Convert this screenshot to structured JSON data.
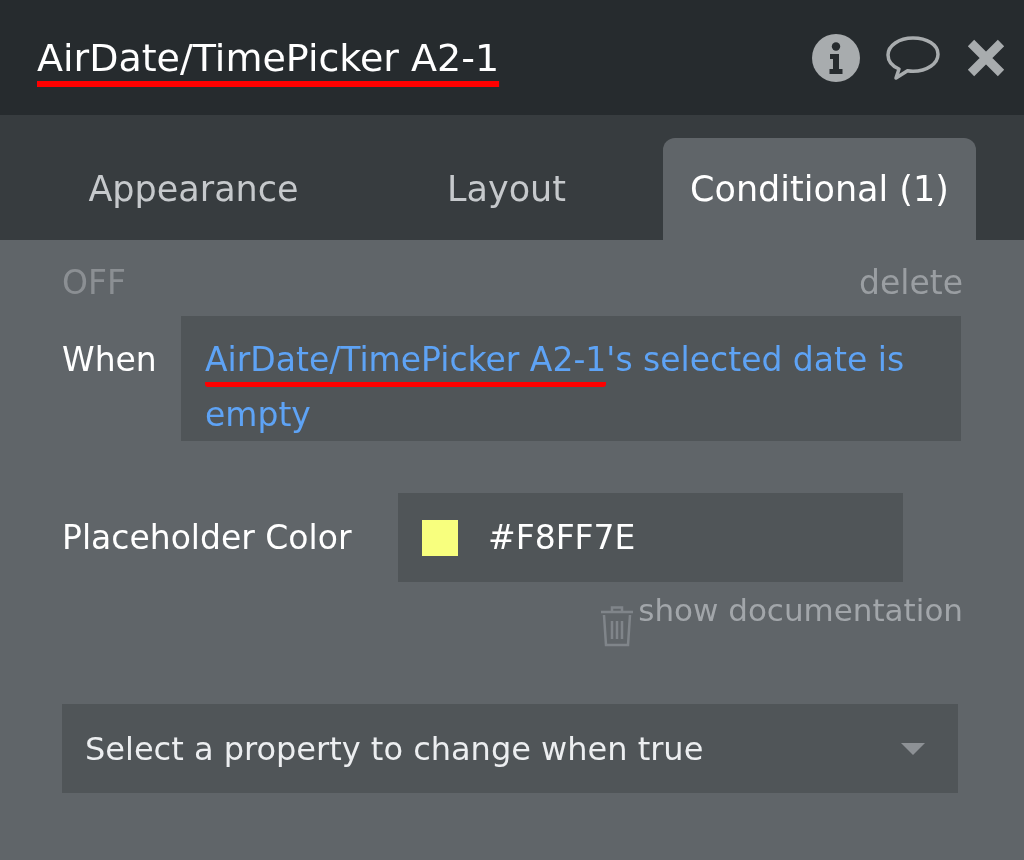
{
  "panel": {
    "title": {
      "text": "AirDate/TimePicker A2-1",
      "underlined": true
    }
  },
  "tabs": [
    {
      "label": "Appearance",
      "selected": false
    },
    {
      "label": "Layout",
      "selected": false
    },
    {
      "label": "Conditional (1)",
      "selected": true
    }
  ],
  "conditional": {
    "status": "OFF",
    "delete_label": "delete",
    "when_label": "When",
    "expression": [
      {
        "text": "AirDate/TimePicker A2-1",
        "underlined": true
      },
      {
        "text": "'s selected date is empty",
        "underlined": false
      }
    ],
    "properties": [
      {
        "kind": "color",
        "label": "Placeholder Color",
        "value": "#F8FF7E",
        "color": "#f8ff7e"
      }
    ],
    "documentation_link": "show documentation",
    "add_property": {
      "placeholder": "Select a property to change when true"
    }
  }
}
